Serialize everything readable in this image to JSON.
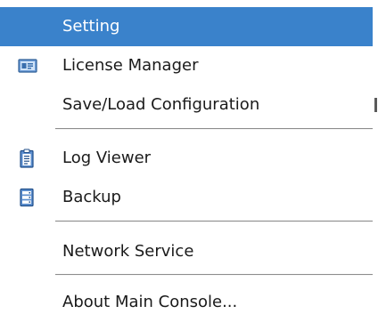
{
  "menu": {
    "highlight_color": "#3a82cb",
    "items": [
      {
        "label": "Setting",
        "icon": "",
        "highlighted": true
      },
      {
        "label": "License Manager",
        "icon": "license-card-icon"
      },
      {
        "label": "Save/Load Configuration",
        "icon": ""
      },
      {
        "label": "Log Viewer",
        "icon": "clipboard-icon"
      },
      {
        "label": "Backup",
        "icon": "backup-stack-icon"
      },
      {
        "label": "Network Service",
        "icon": ""
      },
      {
        "label": "About Main Console...",
        "icon": ""
      }
    ]
  }
}
